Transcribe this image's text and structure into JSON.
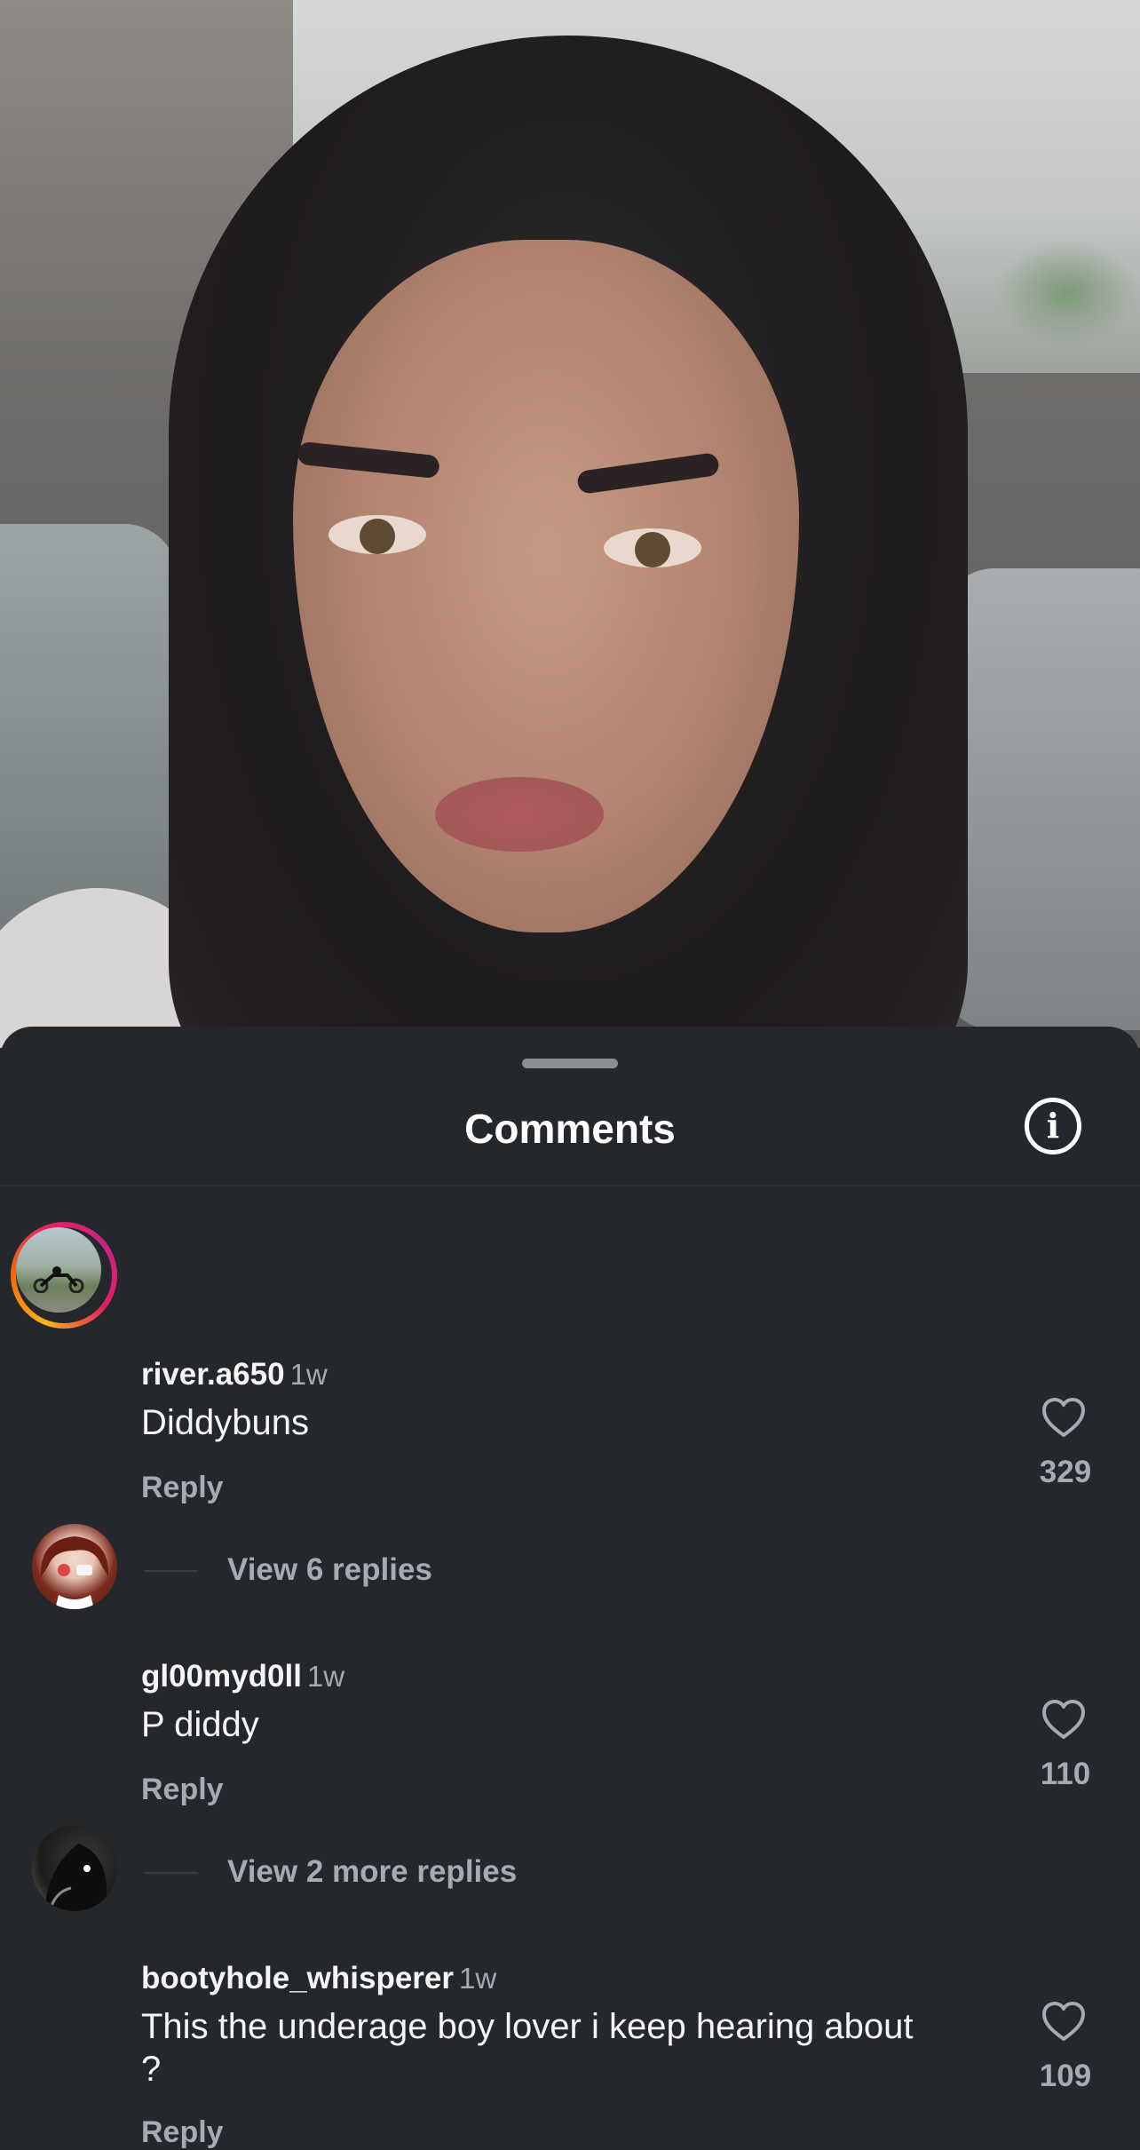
{
  "sheet": {
    "title": "Comments",
    "info_icon": "info-icon"
  },
  "comments": [
    {
      "username": "river.a650",
      "time": "1w",
      "text": "Diddybuns",
      "reply": "Reply",
      "likes": "329",
      "view_replies": "View 6 replies",
      "has_story_ring": true
    },
    {
      "username": "gl00myd0ll",
      "time": "1w",
      "text": "P diddy",
      "reply": "Reply",
      "likes": "110",
      "view_replies": "View 2 more replies",
      "has_story_ring": false
    },
    {
      "username": "bootyhole_whisperer",
      "time": "1w",
      "text": "This the underage boy lover i keep hearing about ?",
      "reply": "Reply",
      "likes": "109",
      "has_story_ring": false
    }
  ],
  "icons": [
    "heart-icon",
    "info-icon"
  ],
  "colors": {
    "sheet_background": "#24272b",
    "secondary_text": "#a7abb1",
    "primary_text": "#f5f5f5"
  }
}
